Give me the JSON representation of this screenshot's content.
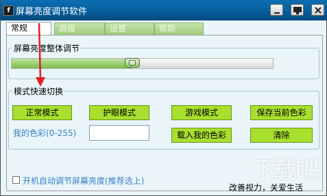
{
  "window": {
    "title": "屏幕亮度调节软件",
    "app_icon": "f",
    "controls": [
      "minimize-icon",
      "restore-icon",
      "close-icon"
    ]
  },
  "tabs": [
    {
      "label": "常规",
      "active": true
    },
    {
      "label": "高级",
      "active": false
    },
    {
      "label": "设置",
      "active": false
    },
    {
      "label": "帮助",
      "active": false
    }
  ],
  "brightness": {
    "group_title": "屏幕亮度整体调节",
    "level_fraction": 0.46
  },
  "modes": {
    "group_title": "模式快速切换",
    "normal": "正常模式",
    "eye_care": "护眼模式",
    "game": "游戏模式",
    "save_color": "保存当前色彩",
    "my_color_label": "我的色彩(0-255)",
    "my_color_value": "",
    "load_color": "载入我的色彩",
    "clear": "清除"
  },
  "footer": {
    "autostart_label": "开机自动调节屏幕亮度(推荐选上)",
    "autostart_checked": false,
    "slogan": "改善视力，关爱生活"
  },
  "colors": {
    "titlebar": "#075e9b",
    "button_green": "#a8e02e",
    "accent_blue_text": "#3a7fc4",
    "annotation_arrow": "#e02020"
  }
}
